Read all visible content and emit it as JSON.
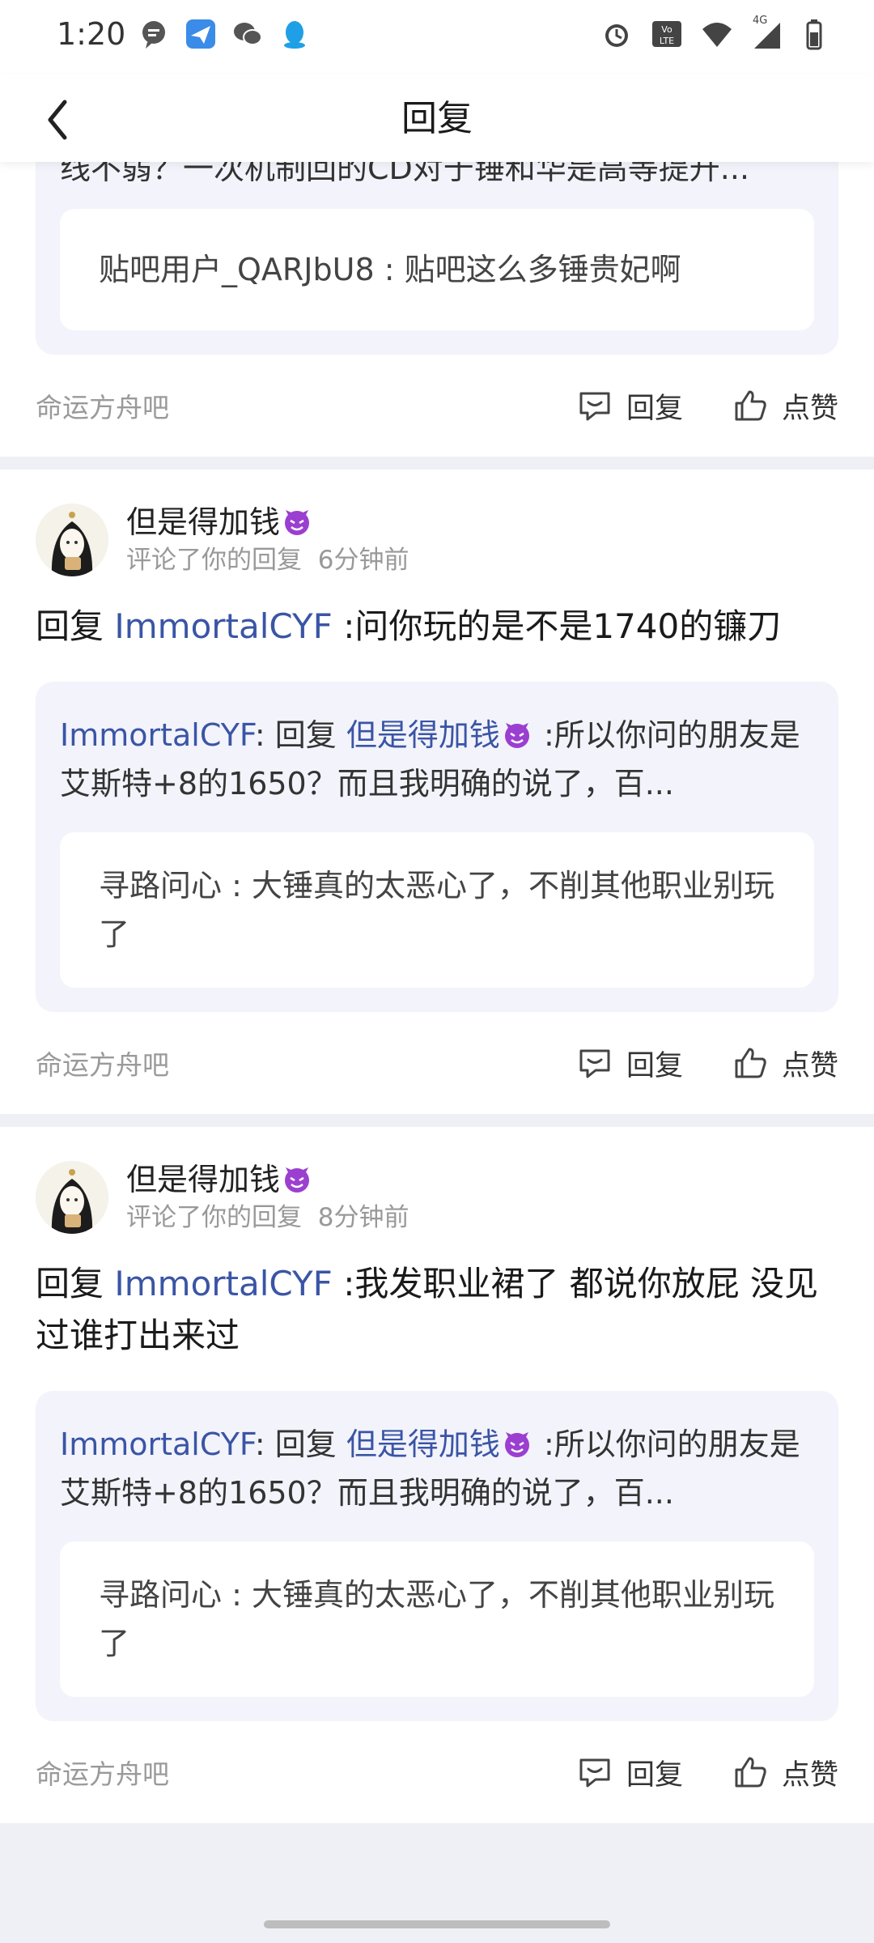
{
  "status_bar": {
    "time": "1:20",
    "network": "4G"
  },
  "nav": {
    "title": "回复"
  },
  "partial_card": {
    "quote_text": "线不弱？一次机制回的CD对于锤和华是高等提升...",
    "inner": {
      "user": "贴吧用户_QARJbU8",
      "text": "贴吧这么多锤贵妃啊"
    },
    "forum": "命运方舟吧",
    "reply_label": "回复",
    "like_label": "点赞"
  },
  "cards": [
    {
      "username": "但是得加钱",
      "action": "评论了你的回复",
      "time": "6分钟前",
      "reply_prefix": "回复",
      "reply_to": "ImmortalCYF",
      "reply_body": ":问你玩的是不是1740的镰刀",
      "quote_user": "ImmortalCYF",
      "quote_mid": ": 回复",
      "quote_mention": "但是得加钱",
      "quote_rest": ":所以你问的朋友是艾斯特+8的1650？而且我明确的说了，百...",
      "inner_user": "寻路问心",
      "inner_text": "大锤真的太恶心了，不削其他职业别玩了",
      "forum": "命运方舟吧",
      "reply_label": "回复",
      "like_label": "点赞"
    },
    {
      "username": "但是得加钱",
      "action": "评论了你的回复",
      "time": "8分钟前",
      "reply_prefix": "回复",
      "reply_to": "ImmortalCYF",
      "reply_body": ":我发职业裙了 都说你放屁 没见过谁打出来过",
      "quote_user": "ImmortalCYF",
      "quote_mid": ": 回复",
      "quote_mention": "但是得加钱",
      "quote_rest": ":所以你问的朋友是艾斯特+8的1650？而且我明确的说了，百...",
      "inner_user": "寻路问心",
      "inner_text": "大锤真的太恶心了，不削其他职业别玩了",
      "forum": "命运方舟吧",
      "reply_label": "回复",
      "like_label": "点赞"
    }
  ],
  "colors": {
    "link": "#3a55a5",
    "muted": "#9a9a9a",
    "quote_bg": "#f3f3fb"
  }
}
